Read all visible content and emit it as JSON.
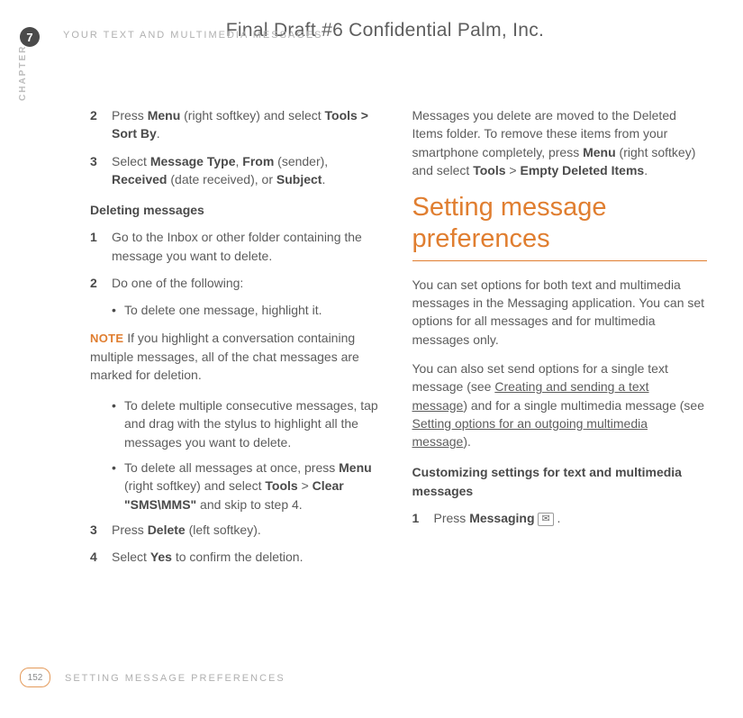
{
  "draft_header": "Final Draft #6    Confidential    Palm, Inc.",
  "chapter_number": "7",
  "running_head": "YOUR TEXT AND MULTIMEDIA MESSAGES",
  "chapter_side": "CHAPTER",
  "left": {
    "step2_num": "2",
    "step2_a": "Press ",
    "step2_b": "Menu",
    "step2_c": " (right softkey) and select ",
    "step2_d": "Tools > Sort By",
    "step2_e": ".",
    "step3_num": "3",
    "step3_a": "Select ",
    "step3_b": "Message Type",
    "step3_c": ", ",
    "step3_d": "From",
    "step3_e": " (sender), ",
    "step3_f": "Received",
    "step3_g": " (date received), or ",
    "step3_h": "Subject",
    "step3_i": ".",
    "del_heading": "Deleting messages",
    "d1_num": "1",
    "d1": "Go to the Inbox or other folder containing the message you want to delete.",
    "d2_num": "2",
    "d2": "Do one of the following:",
    "b1": "To delete one message, highlight it.",
    "note_label": "NOTE",
    "note_text": "  If you highlight a conversation containing multiple messages, all of the chat messages are marked for deletion.",
    "b2": "To delete multiple consecutive messages, tap and drag with the stylus to highlight all the messages you want to delete.",
    "b3_a": "To delete all messages at once, press ",
    "b3_b": "Menu",
    "b3_c": " (right softkey) and select ",
    "b3_d": "Tools",
    "b3_e": " > ",
    "b3_f": "Clear \"SMS\\MMS\"",
    "b3_g": " and skip to step 4.",
    "d3_num": "3",
    "d3_a": "Press ",
    "d3_b": "Delete",
    "d3_c": " (left softkey).",
    "d4_num": "4",
    "d4_a": "Select ",
    "d4_b": "Yes",
    "d4_c": " to confirm the deletion."
  },
  "right": {
    "p1_a": "Messages you delete are moved to the Deleted Items folder. To remove these items from your smartphone completely, press ",
    "p1_b": "Menu",
    "p1_c": " (right softkey) and select ",
    "p1_d": "Tools",
    "p1_e": " > ",
    "p1_f": "Empty Deleted Items",
    "p1_g": ".",
    "title": "Setting message preferences",
    "p2": "You can set options for both text and multimedia messages in the Messaging application. You can set options for all messages and for multimedia messages only.",
    "p3_a": "You can also set send options for a single text message (see ",
    "p3_link1": "Creating and sending a text message",
    "p3_b": ") and for a single multimedia message (see ",
    "p3_link2": "Setting options for an outgoing multimedia message",
    "p3_c": ").",
    "cust_heading": "Customizing settings for text and multimedia messages",
    "c1_num": "1",
    "c1_a": "Press ",
    "c1_b": "Messaging",
    "c1_c": " .",
    "msg_icon": "✉"
  },
  "footer": {
    "page": "152",
    "section": "SETTING MESSAGE PREFERENCES"
  }
}
